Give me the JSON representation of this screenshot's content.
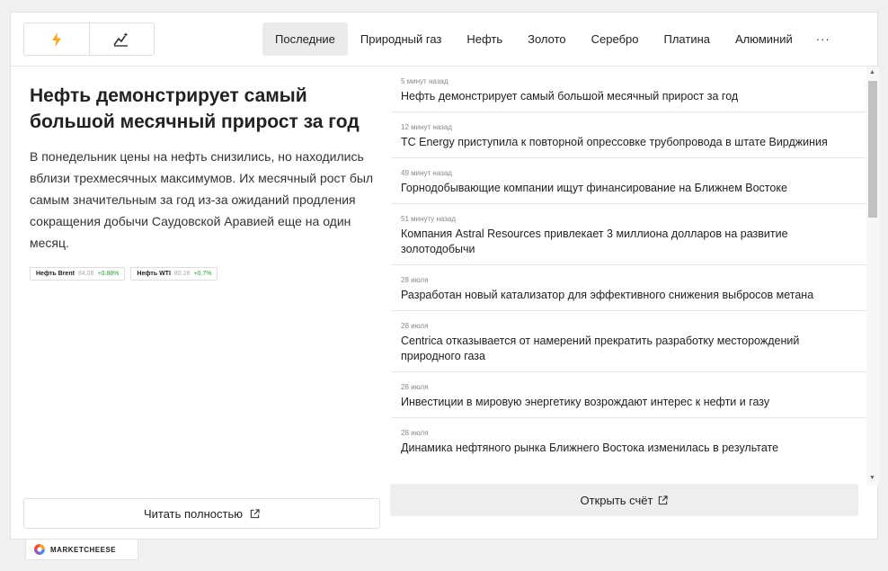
{
  "tabs": [
    {
      "label": "Последние",
      "active": true
    },
    {
      "label": "Природный газ"
    },
    {
      "label": "Нефть"
    },
    {
      "label": "Золото"
    },
    {
      "label": "Серебро"
    },
    {
      "label": "Платина"
    },
    {
      "label": "Алюминий"
    },
    {
      "label": "···"
    }
  ],
  "toggle": {
    "left_icon": "lightning-icon",
    "right_icon": "chart-sparkle-icon",
    "accent": "#f5a623"
  },
  "article": {
    "headline": "Нефть демонстрирует самый большой месячный прирост за год",
    "summary": "В понедельник цены на нефть снизились, но находились вблизи трехмесячных максимумов. Их месячный рост был самым значительным за год из-за ожиданий продления сокращения добычи Саудовской Аравией еще на один месяц.",
    "read_more": "Читать полностью"
  },
  "quotes": [
    {
      "name": "Нефть Brent",
      "price": "84.08",
      "change": "+0.88%"
    },
    {
      "name": "Нефть WTI",
      "price": "80.28",
      "change": "+0.7%"
    }
  ],
  "news": [
    {
      "time": "5 минут назад",
      "title": "Нефть демонстрирует самый большой месячный прирост за год"
    },
    {
      "time": "12 минут назад",
      "title": "TC Energy приступила к повторной опрессовке трубопровода в штате Вирджиния"
    },
    {
      "time": "49 минут назад",
      "title": "Горнодобывающие компании ищут финансирование на Ближнем Востоке"
    },
    {
      "time": "51 минуту назад",
      "title": "Компания Astral Resources привлекает 3 миллиона долларов на развитие золотодобычи"
    },
    {
      "time": "28 июля",
      "title": "Разработан новый катализатор для эффективного снижения выбросов метана"
    },
    {
      "time": "28 июля",
      "title": "Centrica отказывается от намерений прекратить разработку месторождений природного газа"
    },
    {
      "time": "28 июля",
      "title": "Инвестиции в мировую энергетику возрождают интерес к нефти и газу"
    },
    {
      "time": "28 июля",
      "title": "Динамика нефтяного рынка Ближнего Востока изменилась в результате"
    }
  ],
  "open_account": "Открыть счёт",
  "brand": "MARKETCHEESE",
  "colors": {
    "positive": "#2e9e3a",
    "accent": "#f5a623"
  }
}
